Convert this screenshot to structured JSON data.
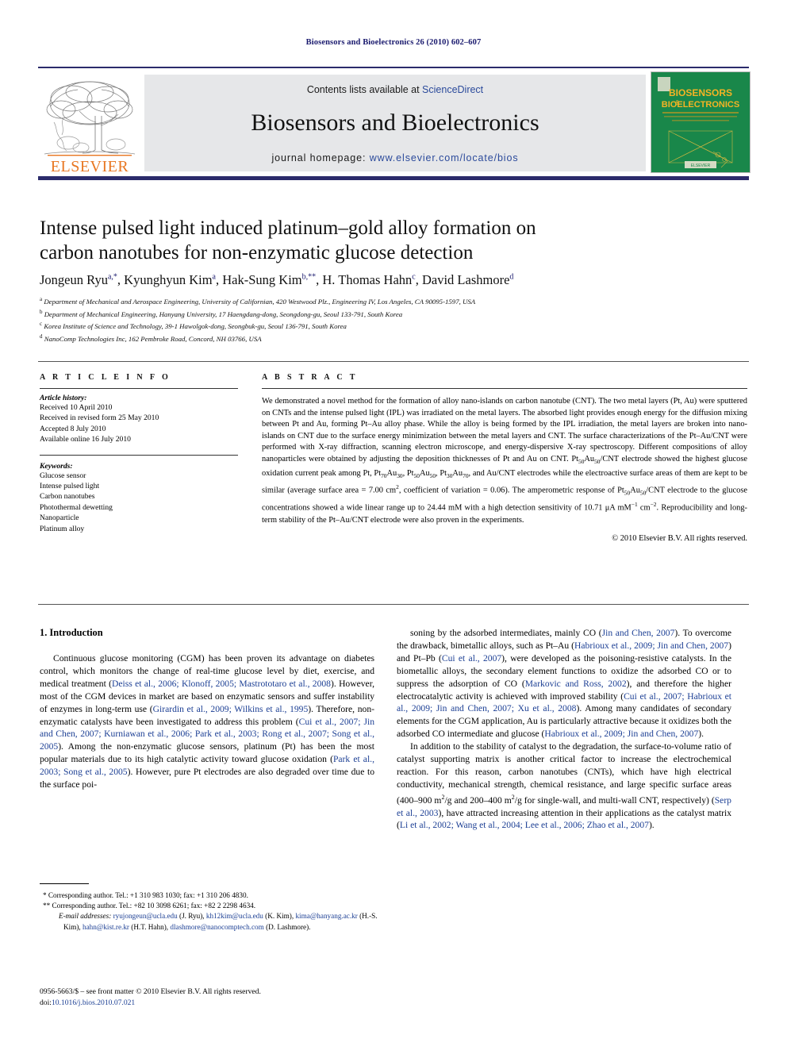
{
  "running_head": "Biosensors and Bioelectronics 26 (2010) 602–607",
  "masthead": {
    "contents_prefix": "Contents lists available at ",
    "sciencedirect": "ScienceDirect",
    "journal_name": "Biosensors and Bioelectronics",
    "homepage_prefix": "journal homepage: ",
    "homepage_url": "www.elsevier.com/locate/bios",
    "publisher_wordmark": "ELSEVIER",
    "cover_line1": "BIOSENSORS",
    "cover_amp": "&",
    "cover_line2": "BIOELECTRONICS",
    "cover_subtitle": "The principal international journal devoted to research, design, development and application of biosensors and bioelectronics"
  },
  "article": {
    "title_line1": "Intense pulsed light induced platinum–gold alloy formation on",
    "title_line2": "carbon nanotubes for non-enzymatic glucose detection",
    "authors": [
      {
        "name": "Jongeun Ryu",
        "marks": "a,*"
      },
      {
        "name": "Kyunghyun Kim",
        "marks": "a"
      },
      {
        "name": "Hak-Sung Kim",
        "marks": "b,**"
      },
      {
        "name": "H. Thomas Hahn",
        "marks": "c"
      },
      {
        "name": "David Lashmore",
        "marks": "d"
      }
    ],
    "affiliations": [
      {
        "mark": "a",
        "text": "Department of Mechanical and Aerospace Engineering, University of Californian, 420 Westwood Plz., Engineering IV, Los Angeles, CA 90095-1597, USA"
      },
      {
        "mark": "b",
        "text": "Department of Mechanical Engineering, Hanyang University, 17 Haengdang-dong, Seongdong-gu, Seoul 133-791, South Korea"
      },
      {
        "mark": "c",
        "text": "Korea Institute of Science and Technology, 39-1 Hawolgok-dong, Seongbuk-gu, Seoul 136-791, South Korea"
      },
      {
        "mark": "d",
        "text": "NanoComp Technologies Inc, 162 Pembroke Road, Concord, NH 03766, USA"
      }
    ]
  },
  "article_info": {
    "heading": "A R T I C L E   I N F O",
    "history_label": "Article history:",
    "history": [
      "Received 10 April 2010",
      "Received in revised form 25 May 2010",
      "Accepted 8 July 2010",
      "Available online 16 July 2010"
    ],
    "keywords_label": "Keywords:",
    "keywords": [
      "Glucose sensor",
      "Intense pulsed light",
      "Carbon nanotubes",
      "Photothermal dewetting",
      "Nanoparticle",
      "Platinum alloy"
    ]
  },
  "abstract": {
    "heading": "A B S T R A C T",
    "paragraph_html": "We demonstrated a novel method for the formation of alloy nano-islands on carbon nanotube (CNT). The two metal layers (Pt, Au) were sputtered on CNTs and the intense pulsed light (IPL) was irradiated on the metal layers. The absorbed light provides enough energy for the diffusion mixing between Pt and Au, forming Pt–Au alloy phase. While the alloy is being formed by the IPL irradiation, the metal layers are broken into nano-islands on CNT due to the surface energy minimization between the metal layers and CNT. The surface characterizations of the Pt–Au/CNT were performed with X-ray diffraction, scanning electron microscope, and energy-dispersive X-ray spectroscopy. Different compositions of alloy nanoparticles were obtained by adjusting the deposition thicknesses of Pt and Au on CNT. Pt<sub>50</sub>Au<sub>50</sub>/CNT electrode showed the highest glucose oxidation current peak among Pt, Pt<sub>70</sub>Au<sub>30</sub>, Pt<sub>50</sub>Au<sub>50</sub>, Pt<sub>30</sub>Au<sub>70</sub>, and Au/CNT electrodes while the electroactive surface areas of them are kept to be similar (average surface area = 7.00 cm<sup>2</sup>, coefficient of variation = 0.06). The amperometric response of Pt<sub>50</sub>Au<sub>50</sub>/CNT electrode to the glucose concentrations showed a wide linear range up to 24.44 mM with a high detection sensitivity of 10.71 μA mM<sup>−1</sup> cm<sup>−2</sup>. Reproducibility and long-term stability of the Pt–Au/CNT electrode were also proven in the experiments.",
    "copyright": "© 2010 Elsevier B.V. All rights reserved."
  },
  "body": {
    "section_heading": "1.  Introduction",
    "left_paragraph_html": "Continuous glucose monitoring (CGM) has been proven its advantage on diabetes control, which monitors the change of real-time glucose level by diet, exercise, and medical treatment (<span class=\"ref\">Deiss et al., 2006; Klonoff, 2005; Mastrototaro et al., 2008</span>). However, most of the CGM devices in market are based on enzymatic sensors and suffer instability of enzymes in long-term use (<span class=\"ref\">Girardin et al., 2009; Wilkins et al., 1995</span>). Therefore, non-enzymatic catalysts have been investigated to address this problem (<span class=\"ref\">Cui et al., 2007; Jin and Chen, 2007; Kurniawan et al., 2006; Park et al., 2003; Rong et al., 2007; Song et al., 2005</span>). Among the non-enzymatic glucose sensors, platinum (Pt) has been the most popular materials due to its high catalytic activity toward glucose oxidation (<span class=\"ref\">Park et al., 2003; Song et al., 2005</span>). However, pure Pt electrodes are also degraded over time due to the surface poi-",
    "right_paragraph1_html": "soning by the adsorbed intermediates, mainly CO (<span class=\"ref\">Jin and Chen, 2007</span>). To overcome the drawback, bimetallic alloys, such as Pt–Au (<span class=\"ref\">Habrioux et al., 2009; Jin and Chen, 2007</span>) and Pt–Pb (<span class=\"ref\">Cui et al., 2007</span>), were developed as the poisoning-resistive catalysts. In the biometallic alloys, the secondary element functions to oxidize the adsorbed CO or to suppress the adsorption of CO (<span class=\"ref\">Markovic and Ross, 2002</span>), and therefore the higher electrocatalytic activity is achieved with improved stability (<span class=\"ref\">Cui et al., 2007; Habrioux et al., 2009; Jin and Chen, 2007; Xu et al., 2008</span>). Among many candidates of secondary elements for the CGM application, Au is particularly attractive because it oxidizes both the adsorbed CO intermediate and glucose (<span class=\"ref\">Habrioux et al., 2009; Jin and Chen, 2007</span>).",
    "right_paragraph2_html": "In addition to the stability of catalyst to the degradation, the surface-to-volume ratio of catalyst supporting matrix is another critical factor to increase the electrochemical reaction. For this reason, carbon nanotubes (CNTs), which have high electrical conductivity, mechanical strength, chemical resistance, and large specific surface areas (400–900 m<sup>2</sup>/g and 200–400 m<sup>2</sup>/g for single-wall, and multi-wall CNT, respectively) (<span class=\"ref\">Serp et al., 2003</span>), have attracted increasing attention in their applications as the catalyst matrix (<span class=\"ref\">Li et al., 2002; Wang et al., 2004; Lee et al., 2006; Zhao et al., 2007</span>)."
  },
  "footnotes": {
    "line1": "* Corresponding author. Tel.: +1 310 983 1030; fax: +1 310 206 4830.",
    "line2": "** Corresponding author. Tel.: +82 10 3098 6261; fax: +82 2 2298 4634.",
    "emails_html": "<span class=\"foot-ital\">E-mail addresses:</span> <span class=\"email\">ryujongeun@ucla.edu</span> (J. Ryu), <span class=\"email\">kh12kim@ucla.edu</span> (K. Kim), <span class=\"email\">kima@hanyang.ac.kr</span> (H.-S. Kim), <span class=\"email\">hahn@kist.re.kr</span> (H.T. Hahn), <span class=\"email\">dlashmore@nanocomptech.com</span> (D. Lashmore).",
    "issn_line": "0956-5663/$ – see front matter © 2010 Elsevier B.V. All rights reserved.",
    "doi_prefix": "doi:",
    "doi": "10.1016/j.bios.2010.07.021"
  }
}
